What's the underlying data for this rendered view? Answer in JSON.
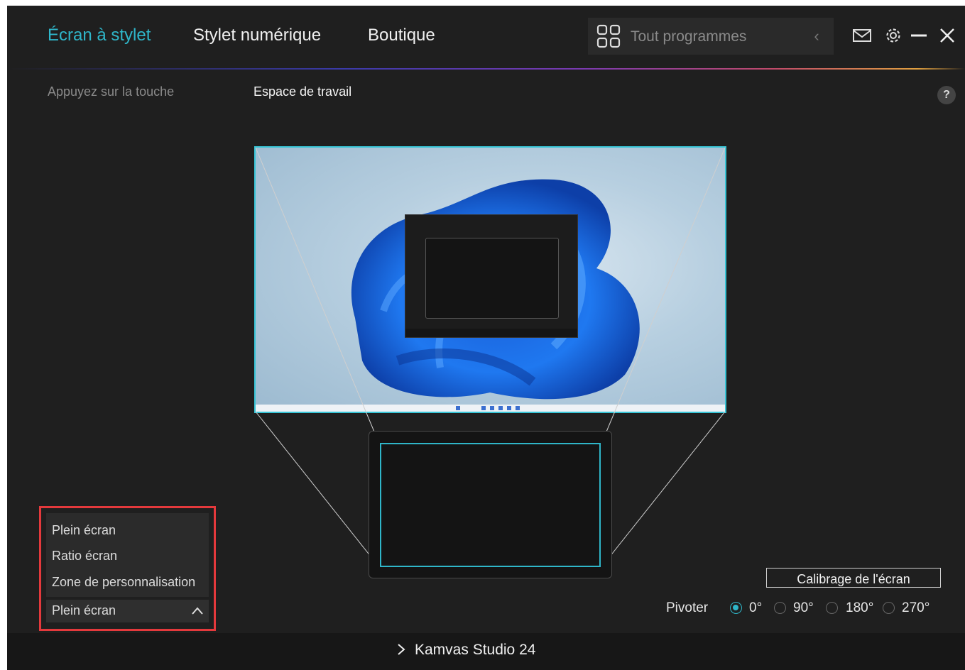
{
  "header": {
    "tabs": [
      {
        "label": "Écran à stylet",
        "active": true
      },
      {
        "label": "Stylet numérique",
        "active": false
      },
      {
        "label": "Boutique",
        "active": false
      }
    ],
    "search": {
      "placeholder": "Tout programmes",
      "icon": "grid-icon",
      "back_icon": "chevron-left-icon"
    },
    "window_icons": [
      "mail-icon",
      "gear-icon",
      "minimize-icon",
      "close-icon"
    ]
  },
  "subtabs": [
    {
      "label": "Appuyez sur la touche",
      "active": false
    },
    {
      "label": "Espace de travail",
      "active": true
    }
  ],
  "help_label": "?",
  "mapping": {
    "mode_options": [
      "Plein écran",
      "Ratio écran",
      "Zone de personnalisation"
    ],
    "selected_mode": "Plein écran"
  },
  "calibrate_label": "Calibrage de l'écran",
  "rotation": {
    "label": "Pivoter",
    "options": [
      "0°",
      "90°",
      "180°",
      "270°"
    ],
    "selected": "0°"
  },
  "footer": {
    "device_name": "Kamvas Studio 24",
    "icon": "chevron-right-icon"
  },
  "colors": {
    "accent": "#2fb6c9",
    "background": "#1f1f1f",
    "highlight_border": "#e4393c"
  }
}
